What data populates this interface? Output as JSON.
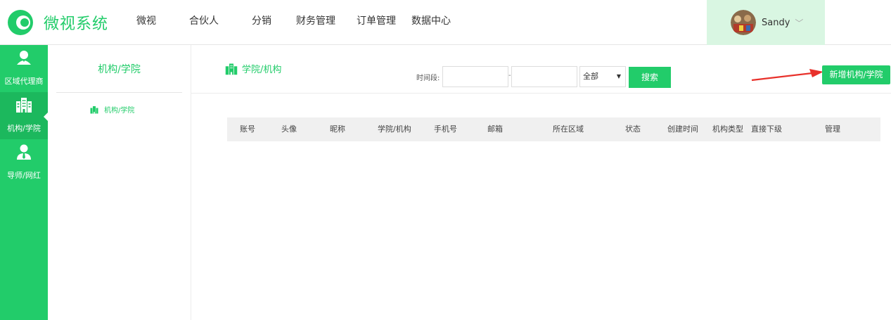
{
  "app": {
    "title": "微视系统"
  },
  "nav": {
    "items": [
      {
        "label": "微视"
      },
      {
        "label": "合伙人"
      },
      {
        "label": "分销"
      },
      {
        "label": "财务管理"
      },
      {
        "label": "订单管理"
      },
      {
        "label": "数据中心"
      }
    ],
    "active_index": 1
  },
  "user": {
    "name": "Sandy",
    "chevron": "﹀"
  },
  "sidebar": {
    "items": [
      {
        "label": "区域代理商",
        "icon": "user-badge-icon"
      },
      {
        "label": "机构/学院",
        "icon": "building-icon",
        "active": true
      },
      {
        "label": "导师/网红",
        "icon": "person-tie-icon"
      }
    ]
  },
  "submenu": {
    "title": "机构/学院",
    "items": [
      {
        "label": "机构/学院",
        "icon": "building-icon"
      }
    ]
  },
  "main": {
    "breadcrumb": "学院/机构",
    "filter": {
      "label": "时间段:",
      "start_value": "",
      "separator": "-",
      "end_value": "",
      "select_value": "全部",
      "search_label": "搜索"
    },
    "add_label": "新增机构/学院",
    "table": {
      "columns": [
        "账号",
        "头像",
        "昵称",
        "学院/机构",
        "手机号",
        "邮箱",
        "所在区域",
        "状态",
        "创建时间",
        "机构类型",
        "直接下级",
        "管理"
      ],
      "rows": []
    }
  },
  "colors": {
    "brand": "#22cc6a",
    "brand_dark": "#1cb85d",
    "user_box": "#d9f6e2",
    "arrow": "#e8312b"
  }
}
